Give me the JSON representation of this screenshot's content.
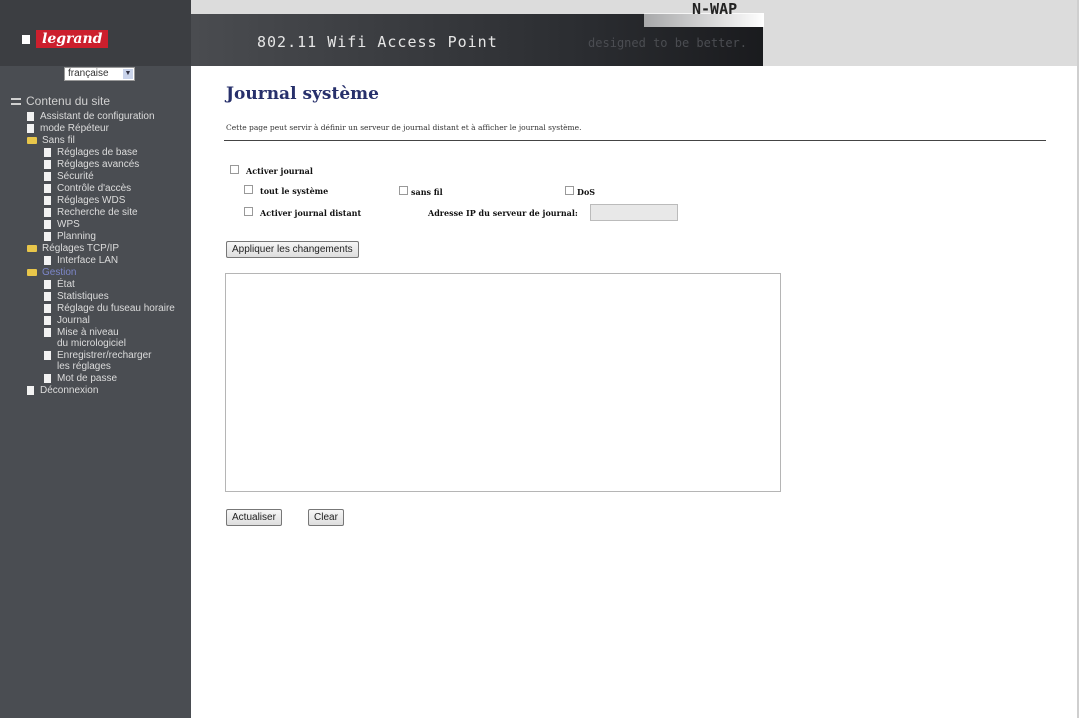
{
  "header": {
    "brand": "legrand",
    "title": "802.11 Wifi Access Point",
    "tagline": "designed to be better.",
    "model": "N-WAP"
  },
  "sidebar": {
    "language": "française",
    "root": "Contenu du site",
    "items": [
      {
        "label": "Assistant de configuration"
      },
      {
        "label": "mode Répéteur"
      },
      {
        "label": "Sans fil"
      },
      {
        "label": "Réglages de base"
      },
      {
        "label": "Réglages avancés"
      },
      {
        "label": "Sécurité"
      },
      {
        "label": "Contrôle d'accès"
      },
      {
        "label": "Réglages WDS"
      },
      {
        "label": "Recherche de site"
      },
      {
        "label": "WPS"
      },
      {
        "label": "Planning"
      },
      {
        "label": "Réglages TCP/IP"
      },
      {
        "label": "Interface LAN"
      },
      {
        "label": "Gestion"
      },
      {
        "label": "État"
      },
      {
        "label": "Statistiques"
      },
      {
        "label": "Réglage du fuseau horaire"
      },
      {
        "label": "Journal"
      },
      {
        "label": "Mise à niveau"
      },
      {
        "label": "du micrologiciel"
      },
      {
        "label": "Enregistrer/recharger"
      },
      {
        "label": "les réglages"
      },
      {
        "label": "Mot de passe"
      },
      {
        "label": "Déconnexion"
      }
    ]
  },
  "main": {
    "title": "Journal système",
    "description": "Cette page peut servir à définir un serveur de journal distant et à afficher le journal système.",
    "enable_log": "Activer journal",
    "all_system": "tout le système",
    "wireless": "sans fil",
    "dos": "DoS",
    "enable_remote": "Activer journal distant",
    "server_ip_label": "Adresse IP du serveur de journal:",
    "server_ip_value": "",
    "apply_button": "Appliquer les changements",
    "log_content": "",
    "refresh_button": "Actualiser",
    "clear_button": "Clear"
  },
  "colors": {
    "sidebar_bg": "#4a4d52",
    "title_color": "#27306b",
    "brand_red": "#cc1f2d",
    "folder_yellow": "#e8c64a"
  }
}
